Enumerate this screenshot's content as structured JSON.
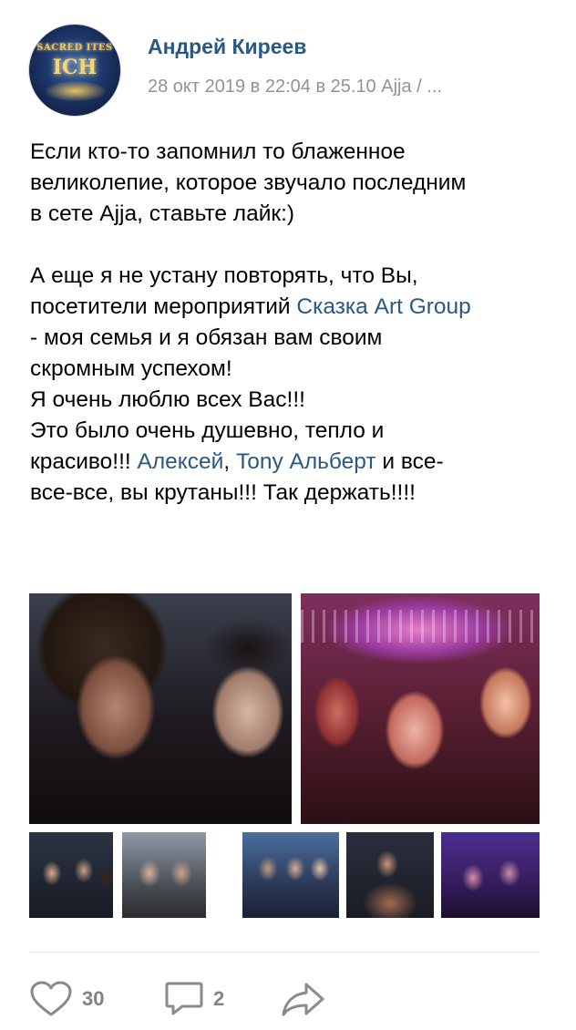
{
  "post": {
    "author": "Андрей Киреев",
    "meta": "28 окт 2019 в 22:04 в 25.10 Ajja / ...",
    "avatar": {
      "logo_top": "SACRED ITES",
      "logo_main": "ICH"
    },
    "text_lines": [
      {
        "t": "Если кто-то запомнил то блаженное"
      },
      {
        "t": "великолепие, которое звучало последним"
      },
      {
        "t": "в сете Ajja, ставьте лайк:)"
      },
      {
        "t": "А еще я не устану повторять, что Вы,"
      },
      {
        "pre": "посетители мероприятий ",
        "link": "Сказка Art Group"
      },
      {
        "t": "- моя семья и я обязан вам своим"
      },
      {
        "t": "скромным успехом!"
      },
      {
        "t": "Я очень люблю всех Вас!!!"
      },
      {
        "t": "Это было очень душевно, тепло и"
      },
      {
        "pre": "красиво!!! ",
        "link1": "Алексей",
        "mid": ", ",
        "link2": "Tony Альберт",
        "post": " и все-"
      },
      {
        "t": "все-все, вы крутаны!!! Так держать!!!!"
      }
    ],
    "actions": {
      "likes": "30",
      "comments": "2"
    },
    "icons": {
      "like": "heart-icon",
      "comment": "comment-icon",
      "share": "share-arrow-icon"
    },
    "colors": {
      "link": "#2a5885",
      "muted": "#939393",
      "divider": "#e7e8ec"
    }
  }
}
